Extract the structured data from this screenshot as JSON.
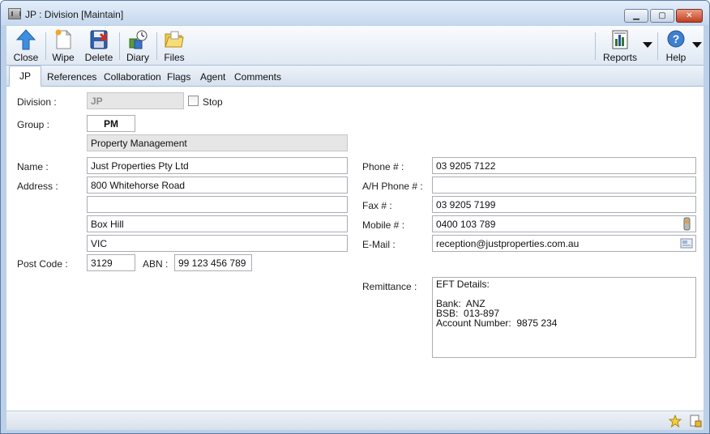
{
  "window": {
    "title": "JP : Division [Maintain]"
  },
  "toolbar": {
    "close_label": "Close",
    "wipe_label": "Wipe",
    "delete_label": "Delete",
    "diary_label": "Diary",
    "files_label": "Files",
    "reports_label": "Reports",
    "help_label": "Help"
  },
  "tabs": [
    {
      "label": "JP"
    },
    {
      "label": "References"
    },
    {
      "label": "Collaboration"
    },
    {
      "label": "Flags"
    },
    {
      "label": "Agent"
    },
    {
      "label": "Comments"
    }
  ],
  "form": {
    "division_label": "Division :",
    "division_value": "JP",
    "stop_label": "Stop",
    "group_label": "Group :",
    "group_code": "PM",
    "group_name": "Property Management",
    "name_label": "Name :",
    "name_value": "Just Properties Pty Ltd",
    "address_label": "Address :",
    "address_line1": "800 Whitehorse Road",
    "address_line2": "",
    "address_line3": "Box Hill",
    "address_line4": "VIC",
    "postcode_label": "Post Code :",
    "postcode_value": "3129",
    "abn_label": "ABN :",
    "abn_value": "99 123 456 789",
    "phone_label": "Phone # :",
    "phone_value": "03 9205 7122",
    "ah_phone_label": "A/H Phone # :",
    "ah_phone_value": "",
    "fax_label": "Fax # :",
    "fax_value": "03 9205 7199",
    "mobile_label": "Mobile # :",
    "mobile_value": "0400 103 789",
    "email_label": "E-Mail :",
    "email_value": "reception@justproperties.com.au",
    "remittance_label": "Remittance :",
    "remittance_value": "EFT Details:\n\nBank:  ANZ\nBSB:  013-897\nAccount Number:  9875 234"
  },
  "colors": {
    "window_frame": "#bcd0e8",
    "close_button": "#c1401f",
    "readonly_field": "#e6e6e6"
  }
}
